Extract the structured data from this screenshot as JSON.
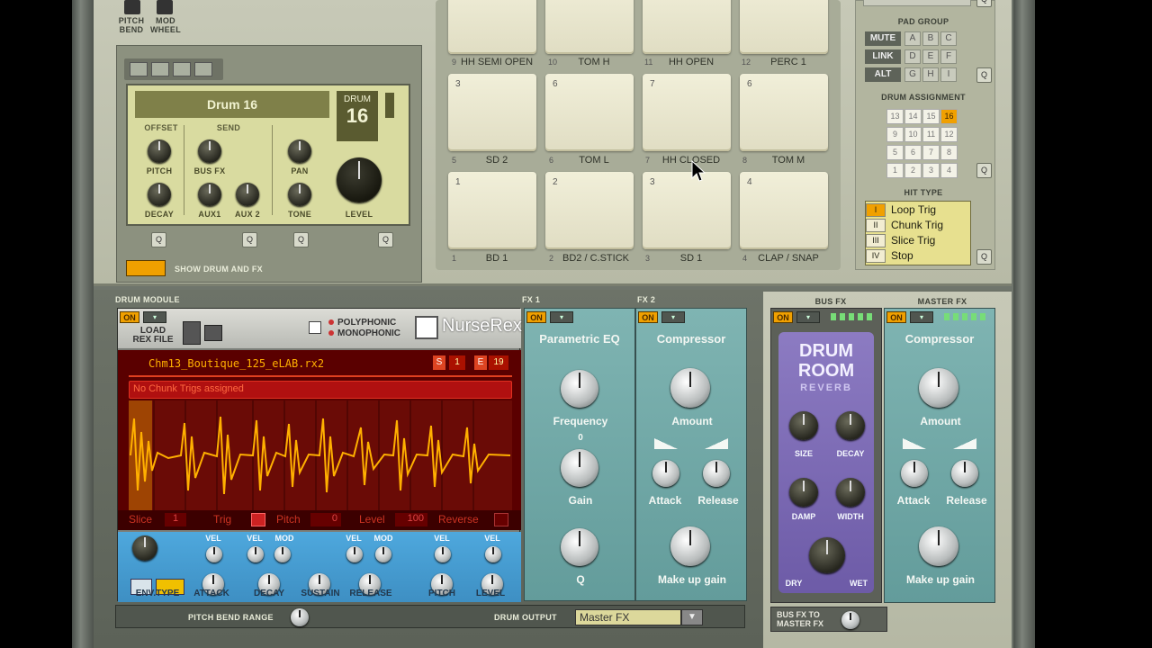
{
  "top_controls": {
    "pitch_bend": "PITCH\nBEND",
    "mod_wheel": "MOD\nWHEEL"
  },
  "drum_display": {
    "name": "Drum 16",
    "drum_label": "DRUM",
    "drum_number": "16",
    "offset": "OFFSET",
    "send": "SEND",
    "pitch": "PITCH",
    "decay": "DECAY",
    "bus_fx": "BUS FX",
    "aux1": "AUX1",
    "aux2": "AUX 2",
    "pan": "PAN",
    "tone": "TONE",
    "level": "LEVEL",
    "show_drum_fx": "SHOW DRUM AND FX"
  },
  "pads": [
    {
      "idx": "9",
      "name": "HH SEMI OPEN"
    },
    {
      "idx": "10",
      "name": "TOM H"
    },
    {
      "idx": "11",
      "name": "HH OPEN"
    },
    {
      "idx": "12",
      "name": "PERC 1"
    },
    {
      "idx": "5",
      "num": "3",
      "name": "SD 2"
    },
    {
      "idx": "6",
      "num": "6",
      "name": "TOM L"
    },
    {
      "idx": "7",
      "num": "7",
      "name": "HH CLOSED"
    },
    {
      "idx": "8",
      "num": "6",
      "name": "TOM M"
    },
    {
      "idx": "1",
      "num": "1",
      "name": "BD 1"
    },
    {
      "idx": "2",
      "num": "2",
      "name": "BD2 / C.STICK"
    },
    {
      "idx": "3",
      "num": "3",
      "name": "SD 1"
    },
    {
      "idx": "4",
      "num": "4",
      "name": "CLAP / SNAP"
    }
  ],
  "pad_group": {
    "title": "PAD GROUP",
    "mute": "MUTE",
    "link": "LINK",
    "alt": "ALT",
    "letters": [
      "A",
      "B",
      "C",
      "D",
      "E",
      "F",
      "G",
      "H",
      "I"
    ]
  },
  "drum_assignment": {
    "title": "DRUM ASSIGNMENT",
    "cells": [
      "13",
      "14",
      "15",
      "16",
      "9",
      "10",
      "11",
      "12",
      "5",
      "6",
      "7",
      "8",
      "1",
      "2",
      "3",
      "4"
    ],
    "selected": "16"
  },
  "hit_type": {
    "title": "HIT TYPE",
    "items": [
      {
        "num": "I",
        "label": "Loop Trig"
      },
      {
        "num": "II",
        "label": "Chunk Trig"
      },
      {
        "num": "III",
        "label": "Slice Trig"
      },
      {
        "num": "IV",
        "label": "Stop"
      }
    ]
  },
  "drum_module": {
    "title": "DRUM MODULE",
    "on": "ON",
    "load": "LOAD\nREX FILE",
    "polyphonic": "POLYPHONIC",
    "monophonic": "MONOPHONIC",
    "brand": "NurseRex",
    "file": "Chm13_Boutique_125_eLAB.rx2",
    "s_label": "S",
    "s_val": "1",
    "e_label": "E",
    "e_val": "19",
    "chunk_msg": "No Chunk Trigs assigned",
    "slice": "Slice",
    "slice_val": "1",
    "trig": "Trig",
    "pitch": "Pitch",
    "pitch_val": "0",
    "level": "Level",
    "level_val": "100",
    "reverse": "Reverse"
  },
  "envelope": {
    "env_type": "ENV.TYPE",
    "attack": "ATTACK",
    "decay": "DECAY",
    "sustain": "SUSTAIN",
    "release": "RELEASE",
    "pitch": "PITCH",
    "level": "LEVEL",
    "vel": "VEL",
    "mod": "MOD"
  },
  "fx1": {
    "label": "FX 1",
    "name": "Parametric EQ",
    "frequency": "Frequency",
    "gain": "Gain",
    "zero": "0",
    "q": "Q"
  },
  "fx2": {
    "label": "FX 2",
    "name": "Compressor",
    "amount": "Amount",
    "attack": "Attack",
    "release": "Release",
    "makeup": "Make up gain"
  },
  "bus_fx": {
    "label": "BUS FX",
    "reverb_title": "DRUM\nROOM",
    "reverb_sub": "REVERB",
    "size": "SIZE",
    "decay": "DECAY",
    "damp": "DAMP",
    "width": "WIDTH",
    "dry": "DRY",
    "wet": "WET"
  },
  "master_fx": {
    "label": "MASTER FX",
    "name": "Compressor",
    "amount": "Amount",
    "attack": "Attack",
    "release": "Release",
    "makeup": "Make up gain"
  },
  "bottom": {
    "pitch_bend_range": "PITCH BEND RANGE",
    "drum_output": "DRUM OUTPUT",
    "output_value": "Master FX",
    "bus_to_master": "BUS FX TO\nMASTER FX"
  }
}
